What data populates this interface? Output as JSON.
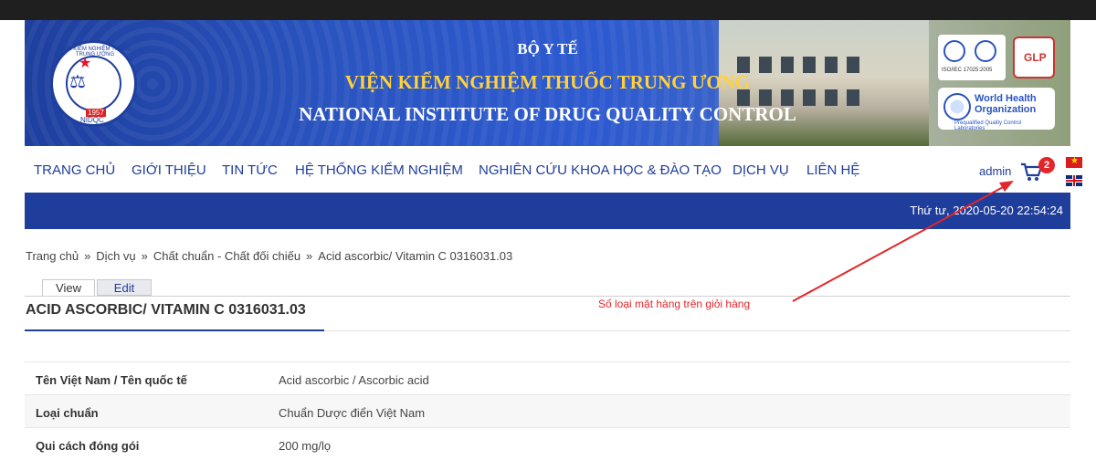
{
  "banner": {
    "title_line1": "BỘ Y TẾ",
    "title_line2": "VIỆN KIỂM NGHIỆM THUỐC TRUNG ƯƠNG",
    "title_line3": "NATIONAL INSTITUTE OF DRUG QUALITY CONTROL",
    "logo": {
      "ring_text": "VIỆN KIỂM NGHIỆM THUỐC TRUNG ƯƠNG",
      "year": "1957",
      "abbr": "NIDQC"
    },
    "badges": {
      "cert_text": "ISO/IEC 17025:2005",
      "glp_text": "GLP",
      "who_line1": "World Health",
      "who_line2": "Organization",
      "who_sub": "Prequalified Quality Control Laboratories"
    }
  },
  "nav": {
    "items": [
      {
        "label": "TRANG CHỦ"
      },
      {
        "label": "GIỚI THIỆU"
      },
      {
        "label": "TIN TỨC"
      },
      {
        "label": "HỆ THỐNG KIỂM NGHIỆM"
      },
      {
        "label": "NGHIÊN CỨU KHOA HỌC & ĐÀO TẠO"
      },
      {
        "label": "DỊCH VỤ"
      },
      {
        "label": "LIÊN HỆ"
      }
    ],
    "user": "admin",
    "cart_count": "2"
  },
  "datebar": {
    "text": "Thứ tư, 2020-05-20 22:54:24"
  },
  "breadcrumb": {
    "items": [
      "Trang chủ",
      "Dịch vụ",
      "Chất chuẩn - Chất đối chiếu",
      "Acid ascorbic/ Vitamin C 0316031.03"
    ],
    "separator": "»"
  },
  "tabs": {
    "view": "View",
    "edit": "Edit"
  },
  "node": {
    "title": "ACID ASCORBIC/ VITAMIN C 0316031.03"
  },
  "annotation": {
    "text": "Số loại mặt hàng trên giỏi hàng",
    "color": "#e2262a"
  },
  "details": [
    {
      "label": "Tên Việt Nam / Tên quốc tế",
      "value": "Acid ascorbic / Ascorbic acid"
    },
    {
      "label": "Loại chuẩn",
      "value": "Chuẩn Dược điển Việt Nam"
    },
    {
      "label": "Qui cách đóng gói",
      "value": "200 mg/lọ"
    }
  ],
  "colors": {
    "brand": "#1f3d9a",
    "accent": "#ffd23a",
    "badge": "#e2262a"
  }
}
